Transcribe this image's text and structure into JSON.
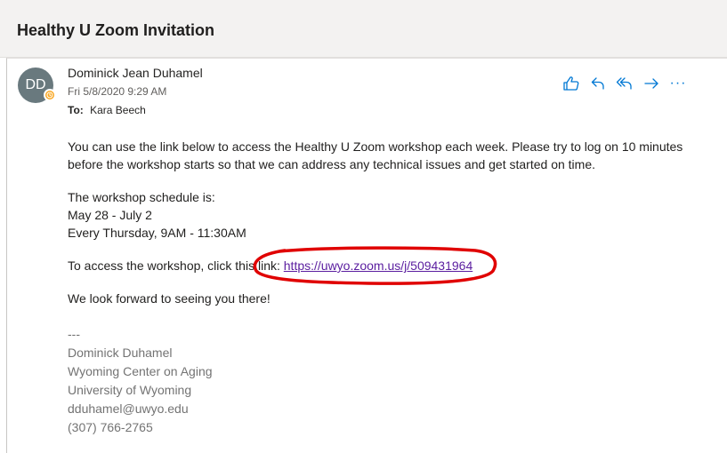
{
  "subject": "Healthy U Zoom Invitation",
  "sender": {
    "initials": "DD",
    "name": "Dominick Jean Duhamel",
    "date": "Fri 5/8/2020 9:29 AM",
    "to_label": "To:",
    "to_value": "Kara Beech"
  },
  "actions": {
    "icons": [
      "like-icon",
      "reply-icon",
      "reply-all-icon",
      "forward-icon",
      "more-icon"
    ],
    "more_label": "···"
  },
  "body": {
    "para1_line1": "You can use the link below to access the Healthy U Zoom workshop each week. Please try to log on 10 minutes",
    "para1_line2": "before the workshop starts so that we can address any technical issues and get started on time.",
    "schedule_heading": "The workshop schedule is:",
    "schedule_dates": "May 28 - July 2",
    "schedule_time": "Every Thursday, 9AM - 11:30AM",
    "access_prefix": "To access the workshop, click this link: ",
    "access_link": "https://uwyo.zoom.us/j/509431964",
    "closing": "We look forward to seeing you there!"
  },
  "signature": {
    "separator": "---",
    "name": "Dominick Duhamel",
    "org": "Wyoming Center on Aging",
    "university": "University of Wyoming",
    "email": "dduhamel@uwyo.edu",
    "phone": "(307) 766-2765"
  },
  "colors": {
    "accent": "#0078d4",
    "link": "#5a1d9f",
    "annotation": "#e00000",
    "avatar": "#69797e",
    "presence": "#f8a825",
    "signature": "#737373"
  }
}
